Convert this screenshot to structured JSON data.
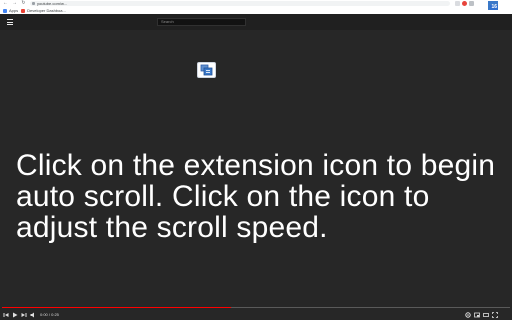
{
  "browser": {
    "url": "youtube.com/w...",
    "bookmarks": [
      {
        "label": "Apps",
        "color": "#4285f4"
      },
      {
        "label": "Developer Dashboa...",
        "color": "#ea4335"
      }
    ],
    "extension_badge": "16",
    "icons": [
      "back-icon",
      "forward-icon",
      "reload-icon",
      "home-icon",
      "lock-icon",
      "star-icon",
      "extension-icon",
      "profile-icon",
      "more-icon"
    ]
  },
  "page": {
    "search_placeholder": "Search",
    "menu_icon": "hamburger-menu-icon",
    "content_icon": "auto-scroll-extension-icon",
    "message": "Click on the extension icon to begin auto scroll. Click on the icon to adjust the scroll speed."
  },
  "player": {
    "time": "0:00 / 0:25",
    "progress_fraction": 0.45,
    "icons": [
      "prev-icon",
      "play-icon",
      "next-icon",
      "volume-icon",
      "settings-icon",
      "miniplayer-icon",
      "theater-icon",
      "fullscreen-icon"
    ]
  },
  "colors": {
    "page_bg": "#272727",
    "topbar_bg": "#202020",
    "progress_played": "#ff0000",
    "extension_blue": "#3a78c8"
  }
}
